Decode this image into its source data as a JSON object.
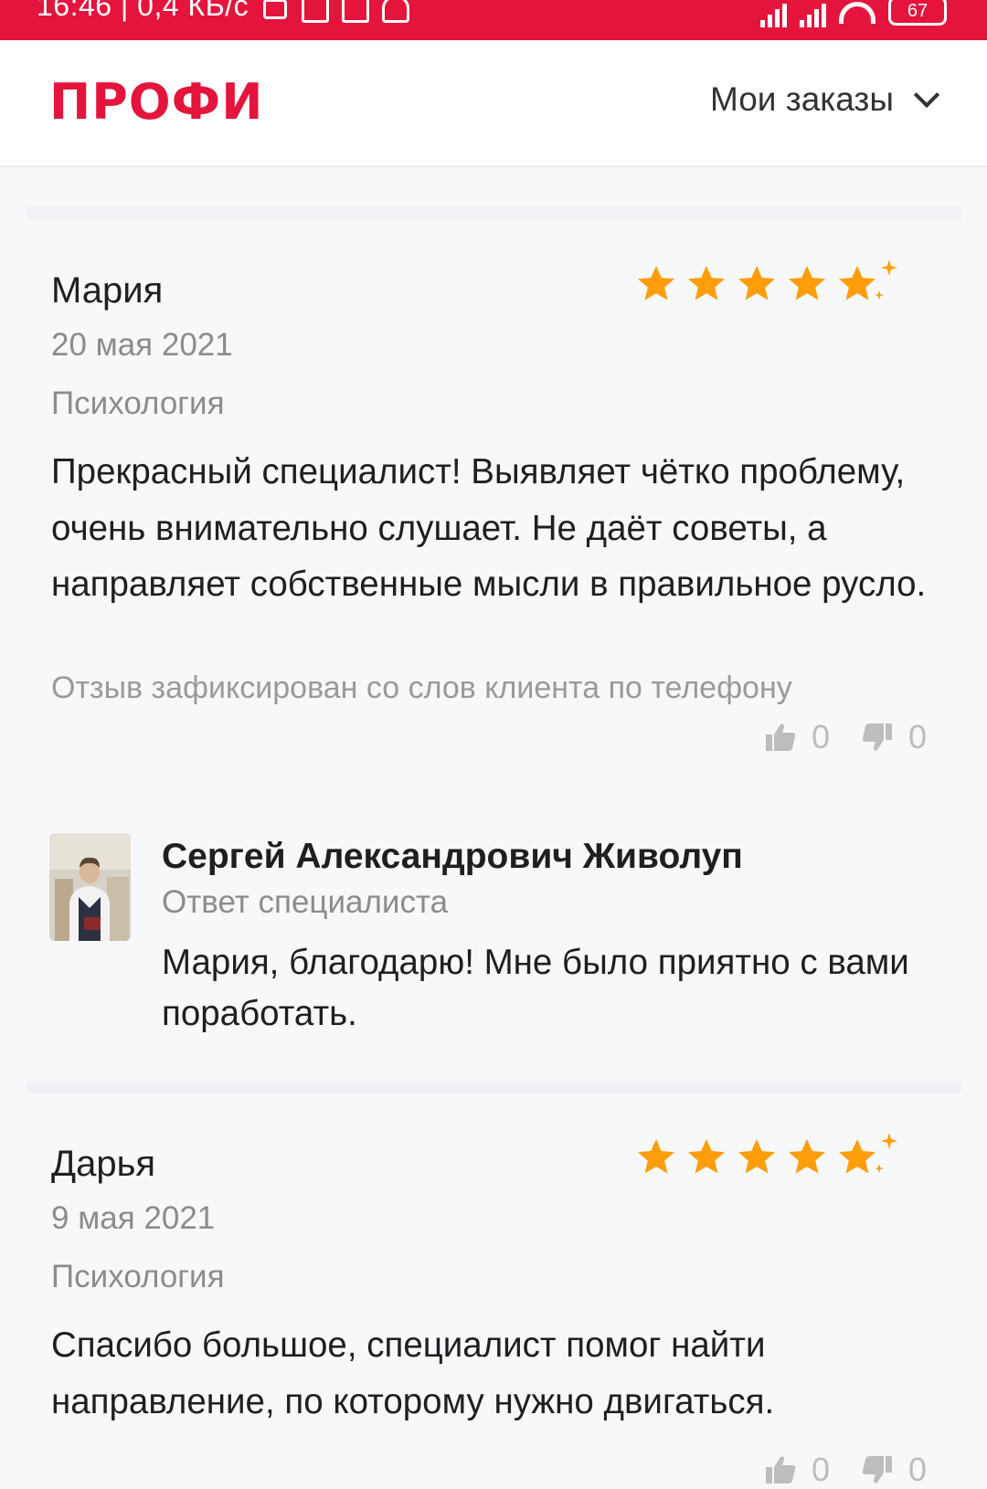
{
  "status_bar": {
    "time_and_speed": "16:46 | 0,4 КБ/с",
    "battery": "67"
  },
  "header": {
    "logo": "ПРОФИ",
    "orders_menu_label": "Мои заказы"
  },
  "colors": {
    "brand_red": "#e4143c",
    "star_orange": "#ff9d0b",
    "muted_text": "#8c8c8c"
  },
  "reviews": [
    {
      "name": "Мария",
      "rating": 5,
      "date": "20 мая 2021",
      "category": "Психология",
      "text": "Прекрасный специалист! Выявляет чётко проблему, очень внимательно слушает. Не даёт советы, а направляет собственные мысли в правильное русло.",
      "note": "Отзыв зафиксирован со слов клиента по телефону",
      "likes": "0",
      "dislikes": "0",
      "reply": {
        "name": "Сергей Александрович Живолуп",
        "role": "Ответ специалиста",
        "text": "Мария, благодарю! Мне было приятно с вами поработать."
      }
    },
    {
      "name": "Дарья",
      "rating": 5,
      "date": "9 мая 2021",
      "category": "Психология",
      "text": "Спасибо большое, специалист помог найти направление, по которому нужно двигаться.",
      "likes": "0",
      "dislikes": "0"
    }
  ]
}
